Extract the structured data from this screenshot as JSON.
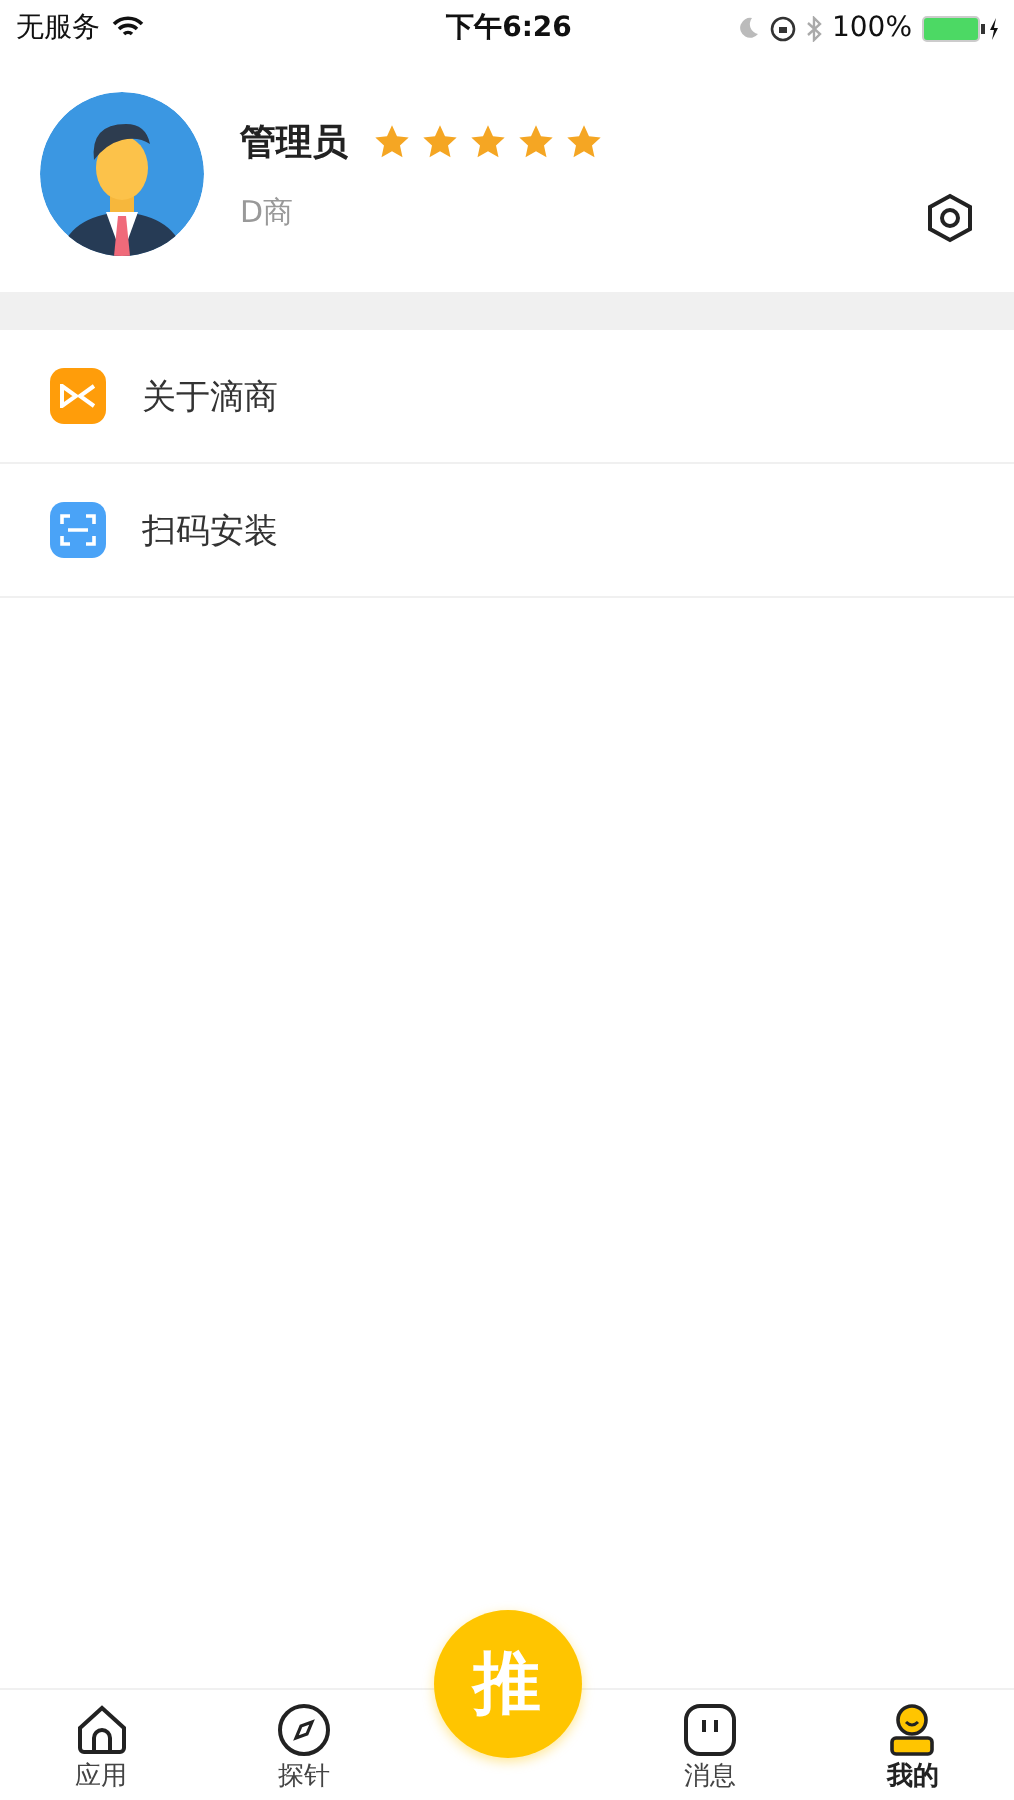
{
  "status_bar": {
    "carrier": "无服务",
    "time": "下午6:26",
    "battery": "100%"
  },
  "profile": {
    "name": "管理员",
    "stars": 5,
    "company": "D商"
  },
  "menu": [
    {
      "kind": "about",
      "label": "关于滴商"
    },
    {
      "kind": "scan",
      "label": "扫码安装"
    }
  ],
  "tab_bar": {
    "items": [
      {
        "kind": "home",
        "label": "应用",
        "selected": false
      },
      {
        "kind": "compass",
        "label": "探针",
        "selected": false
      },
      {
        "kind": "message",
        "label": "消息",
        "selected": false
      },
      {
        "kind": "user",
        "label": "我的",
        "selected": true
      }
    ],
    "center_button": "推"
  }
}
